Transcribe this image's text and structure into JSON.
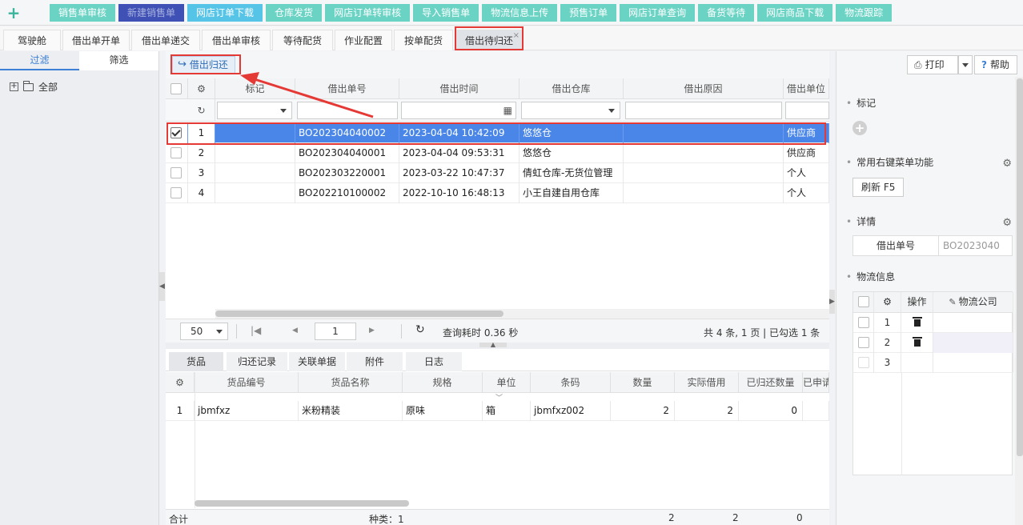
{
  "topbar": {
    "buttons": [
      "销售单审核",
      "新建销售单",
      "网店订单下载",
      "仓库发货",
      "网店订单转审核",
      "导入销售单",
      "物流信息上传",
      "预售订单",
      "网店订单查询",
      "备货等待",
      "网店商品下载",
      "物流跟踪"
    ]
  },
  "tabs": [
    "驾驶舱",
    "借出单开单",
    "借出单递交",
    "借出单审核",
    "等待配货",
    "作业配置",
    "按单配货",
    "借出待归还"
  ],
  "tab_close": "×",
  "left": {
    "tab_filter": "过滤",
    "tab_select": "筛选",
    "tree_expand": "+",
    "tree_root": "全部"
  },
  "toolbar": {
    "return_label": "借出归还",
    "return_icon": "↪"
  },
  "grid": {
    "headers": [
      "标记",
      "借出单号",
      "借出时间",
      "借出仓库",
      "借出原因",
      "借出单位"
    ],
    "rows": [
      {
        "no": "1",
        "bill": "BO202304040002",
        "time": "2023-04-04 10:42:09",
        "warehouse": "悠悠仓",
        "reason": "",
        "unit": "供应商",
        "checked": true
      },
      {
        "no": "2",
        "bill": "BO202304040001",
        "time": "2023-04-04 09:53:31",
        "warehouse": "悠悠仓",
        "reason": "",
        "unit": "供应商",
        "checked": false
      },
      {
        "no": "3",
        "bill": "BO202303220001",
        "time": "2023-03-22 10:47:37",
        "warehouse": "倩虹仓库-无货位管理",
        "reason": "",
        "unit": "个人",
        "checked": false
      },
      {
        "no": "4",
        "bill": "BO202210100002",
        "time": "2022-10-10 16:48:13",
        "warehouse": "小王自建自用仓库",
        "reason": "",
        "unit": "个人",
        "checked": false
      }
    ]
  },
  "pager": {
    "page_size": "50",
    "current_page": "1",
    "query_time": "查询耗时 0.36 秒",
    "summary": "共 4 条, 1 页 | 已勾选 1 条",
    "first_icon": "|◀",
    "prev_icon": "◀",
    "next_icon": "▶",
    "refresh_icon": "↻"
  },
  "subtabs": [
    "货品",
    "归还记录",
    "关联单据",
    "附件",
    "日志"
  ],
  "goods": {
    "headers": [
      "货品编号",
      "货品名称",
      "规格",
      "单位",
      "条码",
      "数量",
      "实际借用",
      "已归还数量",
      "已申请"
    ],
    "row": {
      "no": "1",
      "code": "jbmfxz",
      "name": "米粉精装",
      "spec": "原味",
      "unit": "箱",
      "barcode": "jbmfxz002",
      "qty": "2",
      "borrowed": "2",
      "returned": "0"
    }
  },
  "footer": {
    "total_label": "合计",
    "kinds": "种类：1",
    "qty": "2",
    "borrowed": "2",
    "returned": "0"
  },
  "right": {
    "print": "打印",
    "help": "帮助",
    "help_icon": "?",
    "print_icon": "⎙",
    "mark_title": "标记",
    "mark_add": "+",
    "menu_title": "常用右键菜单功能",
    "refresh_btn": "刷新  F5",
    "detail_title": "详情",
    "detail_label": "借出单号",
    "detail_value": "BO2023040",
    "logistics_title": "物流信息",
    "logistics_headers": [
      "操作",
      "物流公司"
    ],
    "logistics_rows": [
      "1",
      "2",
      "3"
    ],
    "gear_icon": "⚙"
  },
  "colors": {
    "accent": "#6ad3c4",
    "selected_row": "#4a86e8",
    "highlight_box": "#e53935"
  }
}
